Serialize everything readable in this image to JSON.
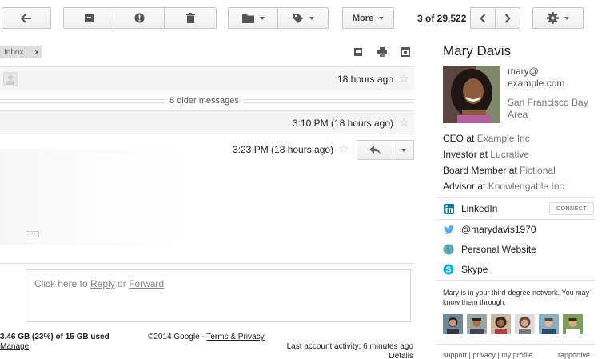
{
  "toolbar": {
    "back_icon": "arrow-left-icon",
    "archive_icon": "archive-icon",
    "spam_icon": "report-spam-icon",
    "delete_icon": "trash-icon",
    "move_icon": "folder-icon",
    "labels_icon": "tag-icon",
    "more_label": "More",
    "pager": "3 of 29,522",
    "settings_icon": "gear-icon"
  },
  "thread": {
    "label_chip": "Inbox",
    "label_chip_close": "x",
    "messages": [
      {
        "time": "18 hours ago"
      },
      {
        "time": "3:10 PM (18 hours ago)"
      }
    ],
    "older_messages": "8 older messages",
    "open_message_time": "3:23 PM (18 hours ago)",
    "reply_box": {
      "prefix": "Click here to ",
      "reply": "Reply",
      "or": " or ",
      "forward": "Forward"
    }
  },
  "footer": {
    "storage": "3.46 GB (23%) of 15 GB used",
    "manage": "Manage",
    "copyright": "©2014 Google - ",
    "terms": "Terms & Privacy",
    "activity": "Last account activity: 6 minutes ago",
    "details": "Details"
  },
  "sidebar": {
    "name": "Mary Davis",
    "email_line1": "mary@",
    "email_line2": "example.com",
    "location_line1": "San Francisco Bay",
    "location_line2": "Area",
    "roles": [
      {
        "title": "CEO at ",
        "company": "Example Inc"
      },
      {
        "title": "Investor at ",
        "company": "Lucrative"
      },
      {
        "title": "Board Member at ",
        "company": "Fictional"
      },
      {
        "title": "Advisor at ",
        "company": "Knowledgable Inc"
      }
    ],
    "links": [
      {
        "label": "LinkedIn",
        "icon": "linkedin-icon"
      },
      {
        "label": "@marydavis1970",
        "icon": "twitter-icon"
      },
      {
        "label": "Personal Website",
        "icon": "globe-icon"
      },
      {
        "label": "Skype",
        "icon": "skype-icon"
      }
    ],
    "connect_label": "CONNECT",
    "network_text": "Mary is in your third-degree network. You may know them through:",
    "footer_links": "support | privacy | my profile",
    "brand": "rapportive"
  },
  "colors": {
    "linkedin": "#0e76a8",
    "twitter": "#55acee",
    "skype": "#00aff0"
  }
}
